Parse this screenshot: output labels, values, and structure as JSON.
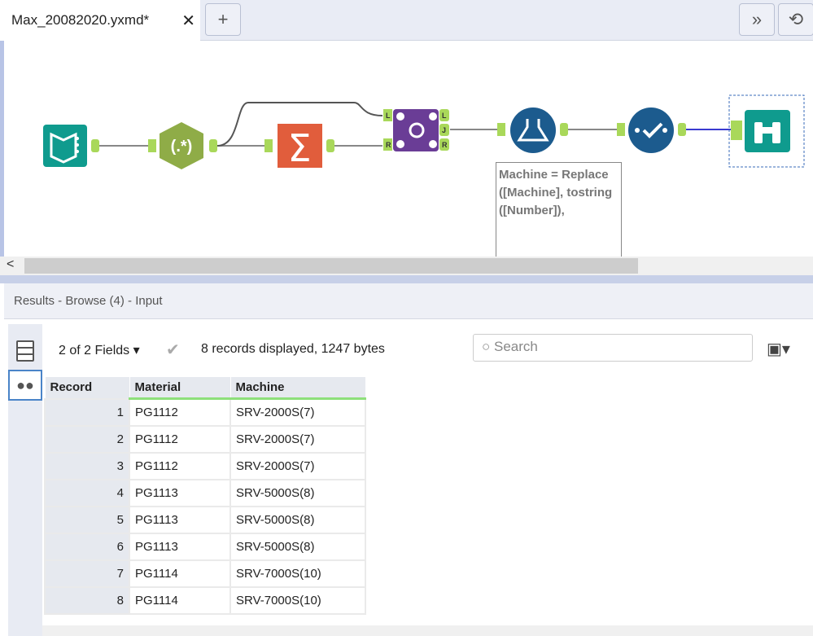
{
  "tab": {
    "title": "Max_20082020.yxmd*",
    "close": "✕",
    "add": "+",
    "overflow": "»",
    "history": "⟲"
  },
  "canvas": {
    "tools": [
      {
        "name": "input"
      },
      {
        "name": "regex",
        "label": "(.*)"
      },
      {
        "name": "summarize",
        "label": "Σ"
      },
      {
        "name": "join",
        "anchors": [
          "L",
          "J",
          "R"
        ],
        "inputs": [
          "L",
          "R"
        ]
      },
      {
        "name": "formula"
      },
      {
        "name": "select"
      },
      {
        "name": "browse"
      }
    ],
    "annotation": "Machine = Replace ([Machine], tostring ([Number]),",
    "colors": {
      "input": "#0f9b8e",
      "regex": "#8fac47",
      "summarize": "#e15d3c",
      "join": "#6a3d96",
      "formula": "#1c5b8e",
      "anchor": "#a9d85a"
    }
  },
  "scroll_left": "<",
  "results": {
    "title": "Results - Browse (4) - Input",
    "fields": "2 of 2 Fields",
    "records": "8 records displayed, 1247 bytes",
    "search_placeholder": "Search",
    "columns": [
      "Record",
      "Material",
      "Machine"
    ],
    "rows": [
      [
        "1",
        "PG1112",
        "SRV-2000S(7)"
      ],
      [
        "2",
        "PG1112",
        "SRV-2000S(7)"
      ],
      [
        "3",
        "PG1112",
        "SRV-2000S(7)"
      ],
      [
        "4",
        "PG1113",
        "SRV-5000S(8)"
      ],
      [
        "5",
        "PG1113",
        "SRV-5000S(8)"
      ],
      [
        "6",
        "PG1113",
        "SRV-5000S(8)"
      ],
      [
        "7",
        "PG1114",
        "SRV-7000S(10)"
      ],
      [
        "8",
        "PG1114",
        "SRV-7000S(10)"
      ]
    ]
  }
}
